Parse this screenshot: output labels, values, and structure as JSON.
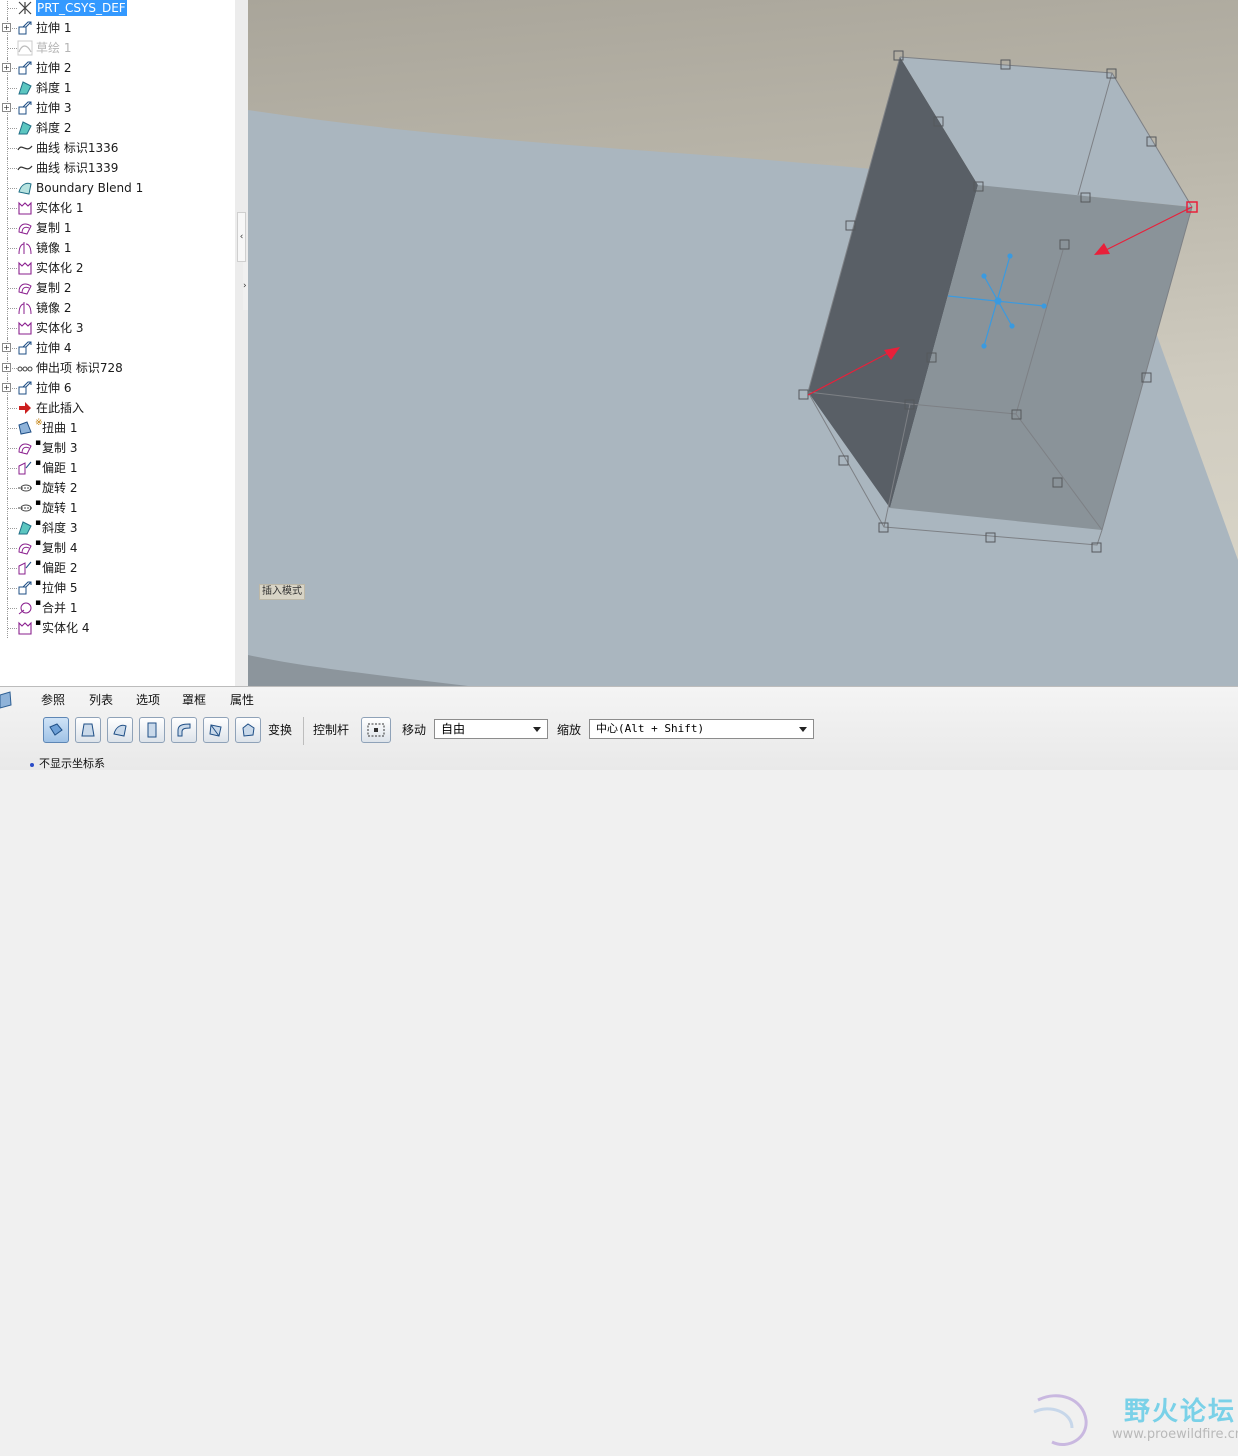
{
  "model_tree": {
    "items": [
      {
        "label": "PRT_CSYS_DEF",
        "icon": "csys-icon",
        "selected": true
      },
      {
        "label": "拉伸 1",
        "icon": "extrude-icon",
        "expandable": true
      },
      {
        "label": "草绘 1",
        "icon": "sketch-icon",
        "suppressed": true
      },
      {
        "label": "拉伸 2",
        "icon": "extrude-icon",
        "expandable": true
      },
      {
        "label": "斜度 1",
        "icon": "draft-icon"
      },
      {
        "label": "拉伸 3",
        "icon": "extrude-icon",
        "expandable": true
      },
      {
        "label": "斜度 2",
        "icon": "draft-icon"
      },
      {
        "label": "曲线 标识1336",
        "icon": "curve-icon"
      },
      {
        "label": "曲线 标识1339",
        "icon": "curve-icon"
      },
      {
        "label": "Boundary Blend 1",
        "icon": "boundary-blend-icon"
      },
      {
        "label": "实体化 1",
        "icon": "solidify-icon"
      },
      {
        "label": "复制 1",
        "icon": "copy-icon"
      },
      {
        "label": "镜像 1",
        "icon": "mirror-icon"
      },
      {
        "label": "实体化 2",
        "icon": "solidify-icon"
      },
      {
        "label": "复制 2",
        "icon": "copy-icon"
      },
      {
        "label": "镜像 2",
        "icon": "mirror-icon"
      },
      {
        "label": "实体化 3",
        "icon": "solidify-icon"
      },
      {
        "label": "拉伸 4",
        "icon": "extrude-icon",
        "expandable": true
      },
      {
        "label": "伸出项 标识728",
        "icon": "protrusion-icon",
        "expandable": true
      },
      {
        "label": "拉伸 6",
        "icon": "extrude-icon",
        "expandable": true
      },
      {
        "label": "在此插入",
        "icon": "insert-here-arrow-icon"
      },
      {
        "label": "扭曲 1",
        "icon": "warp-icon",
        "mark": "※"
      },
      {
        "label": "复制 3",
        "icon": "copy-icon",
        "mark": "▪"
      },
      {
        "label": "偏距 1",
        "icon": "offset-icon",
        "mark": "▪"
      },
      {
        "label": "旋转 2",
        "icon": "revolve-icon",
        "mark": "▪"
      },
      {
        "label": "旋转 1",
        "icon": "revolve-icon",
        "mark": "▪"
      },
      {
        "label": "斜度 3",
        "icon": "draft-icon",
        "mark": "▪"
      },
      {
        "label": "复制 4",
        "icon": "copy-icon",
        "mark": "▪"
      },
      {
        "label": "偏距 2",
        "icon": "offset-icon",
        "mark": "▪"
      },
      {
        "label": "拉伸 5",
        "icon": "extrude-icon",
        "mark": "▪"
      },
      {
        "label": "合并 1",
        "icon": "merge-icon",
        "mark": "▪"
      },
      {
        "label": "实体化 4",
        "icon": "solidify-icon",
        "mark": "▪"
      }
    ]
  },
  "viewport": {
    "mode_label": "插入模式"
  },
  "dashboard": {
    "tabs": [
      "参照",
      "列表",
      "选项",
      "罩框",
      "属性"
    ],
    "transform_label": "变换",
    "handle_label": "控制杆",
    "move_label": "移动",
    "move_value": "自由",
    "scale_label": "缩放",
    "scale_value": "中心(Alt + Shift)",
    "status": "不显示坐标系"
  },
  "watermark": {
    "title": "野火论坛",
    "url": "www.proewildfire.cn"
  },
  "colors": {
    "selection": "#3399ff",
    "body_top": "#aab6bf",
    "box_dark_face": "#595f66",
    "box_front_face": "#8a9399",
    "arrow": "#e8203a",
    "dragger": "#3a9ae0"
  }
}
